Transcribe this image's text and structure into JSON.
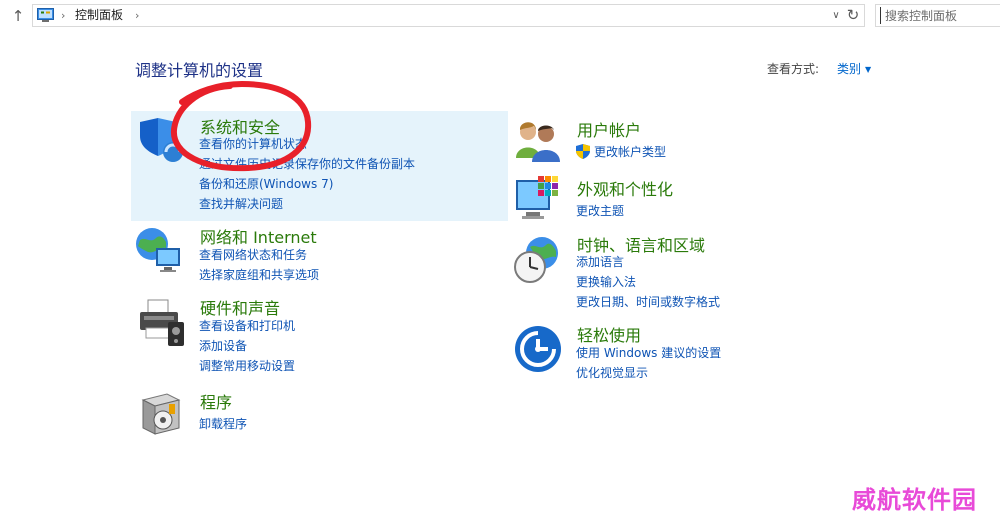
{
  "address_bar": {
    "breadcrumb": "控制面板",
    "search_placeholder": "搜索控制面板"
  },
  "header": {
    "title": "调整计算机的设置",
    "view_by_label": "查看方式:",
    "view_by_value": "类别"
  },
  "categories": {
    "system_security": {
      "title": "系统和安全",
      "links": [
        "查看你的计算机状态",
        "通过文件历史记录保存你的文件备份副本",
        "备份和还原(Windows 7)",
        "查找并解决问题"
      ]
    },
    "network": {
      "title": "网络和 Internet",
      "links": [
        "查看网络状态和任务",
        "选择家庭组和共享选项"
      ]
    },
    "hardware": {
      "title": "硬件和声音",
      "links": [
        "查看设备和打印机",
        "添加设备",
        "调整常用移动设置"
      ]
    },
    "programs": {
      "title": "程序",
      "links": [
        "卸载程序"
      ]
    },
    "user_accounts": {
      "title": "用户帐户",
      "links": [
        "更改帐户类型"
      ]
    },
    "appearance": {
      "title": "外观和个性化",
      "links": [
        "更改主题"
      ]
    },
    "clock_region": {
      "title": "时钟、语言和区域",
      "links": [
        "添加语言",
        "更换输入法",
        "更改日期、时间或数字格式"
      ]
    },
    "ease_of_access": {
      "title": "轻松使用",
      "links": [
        "使用 Windows 建议的设置",
        "优化视觉显示"
      ]
    }
  },
  "watermark": "威航软件园",
  "colors": {
    "category_title": "#2a7a0a",
    "link": "#0f54b4",
    "page_title": "#1e3287",
    "highlight": "#e5f3fb",
    "annotation": "#e8202a",
    "watermark": "#e84ad8"
  }
}
